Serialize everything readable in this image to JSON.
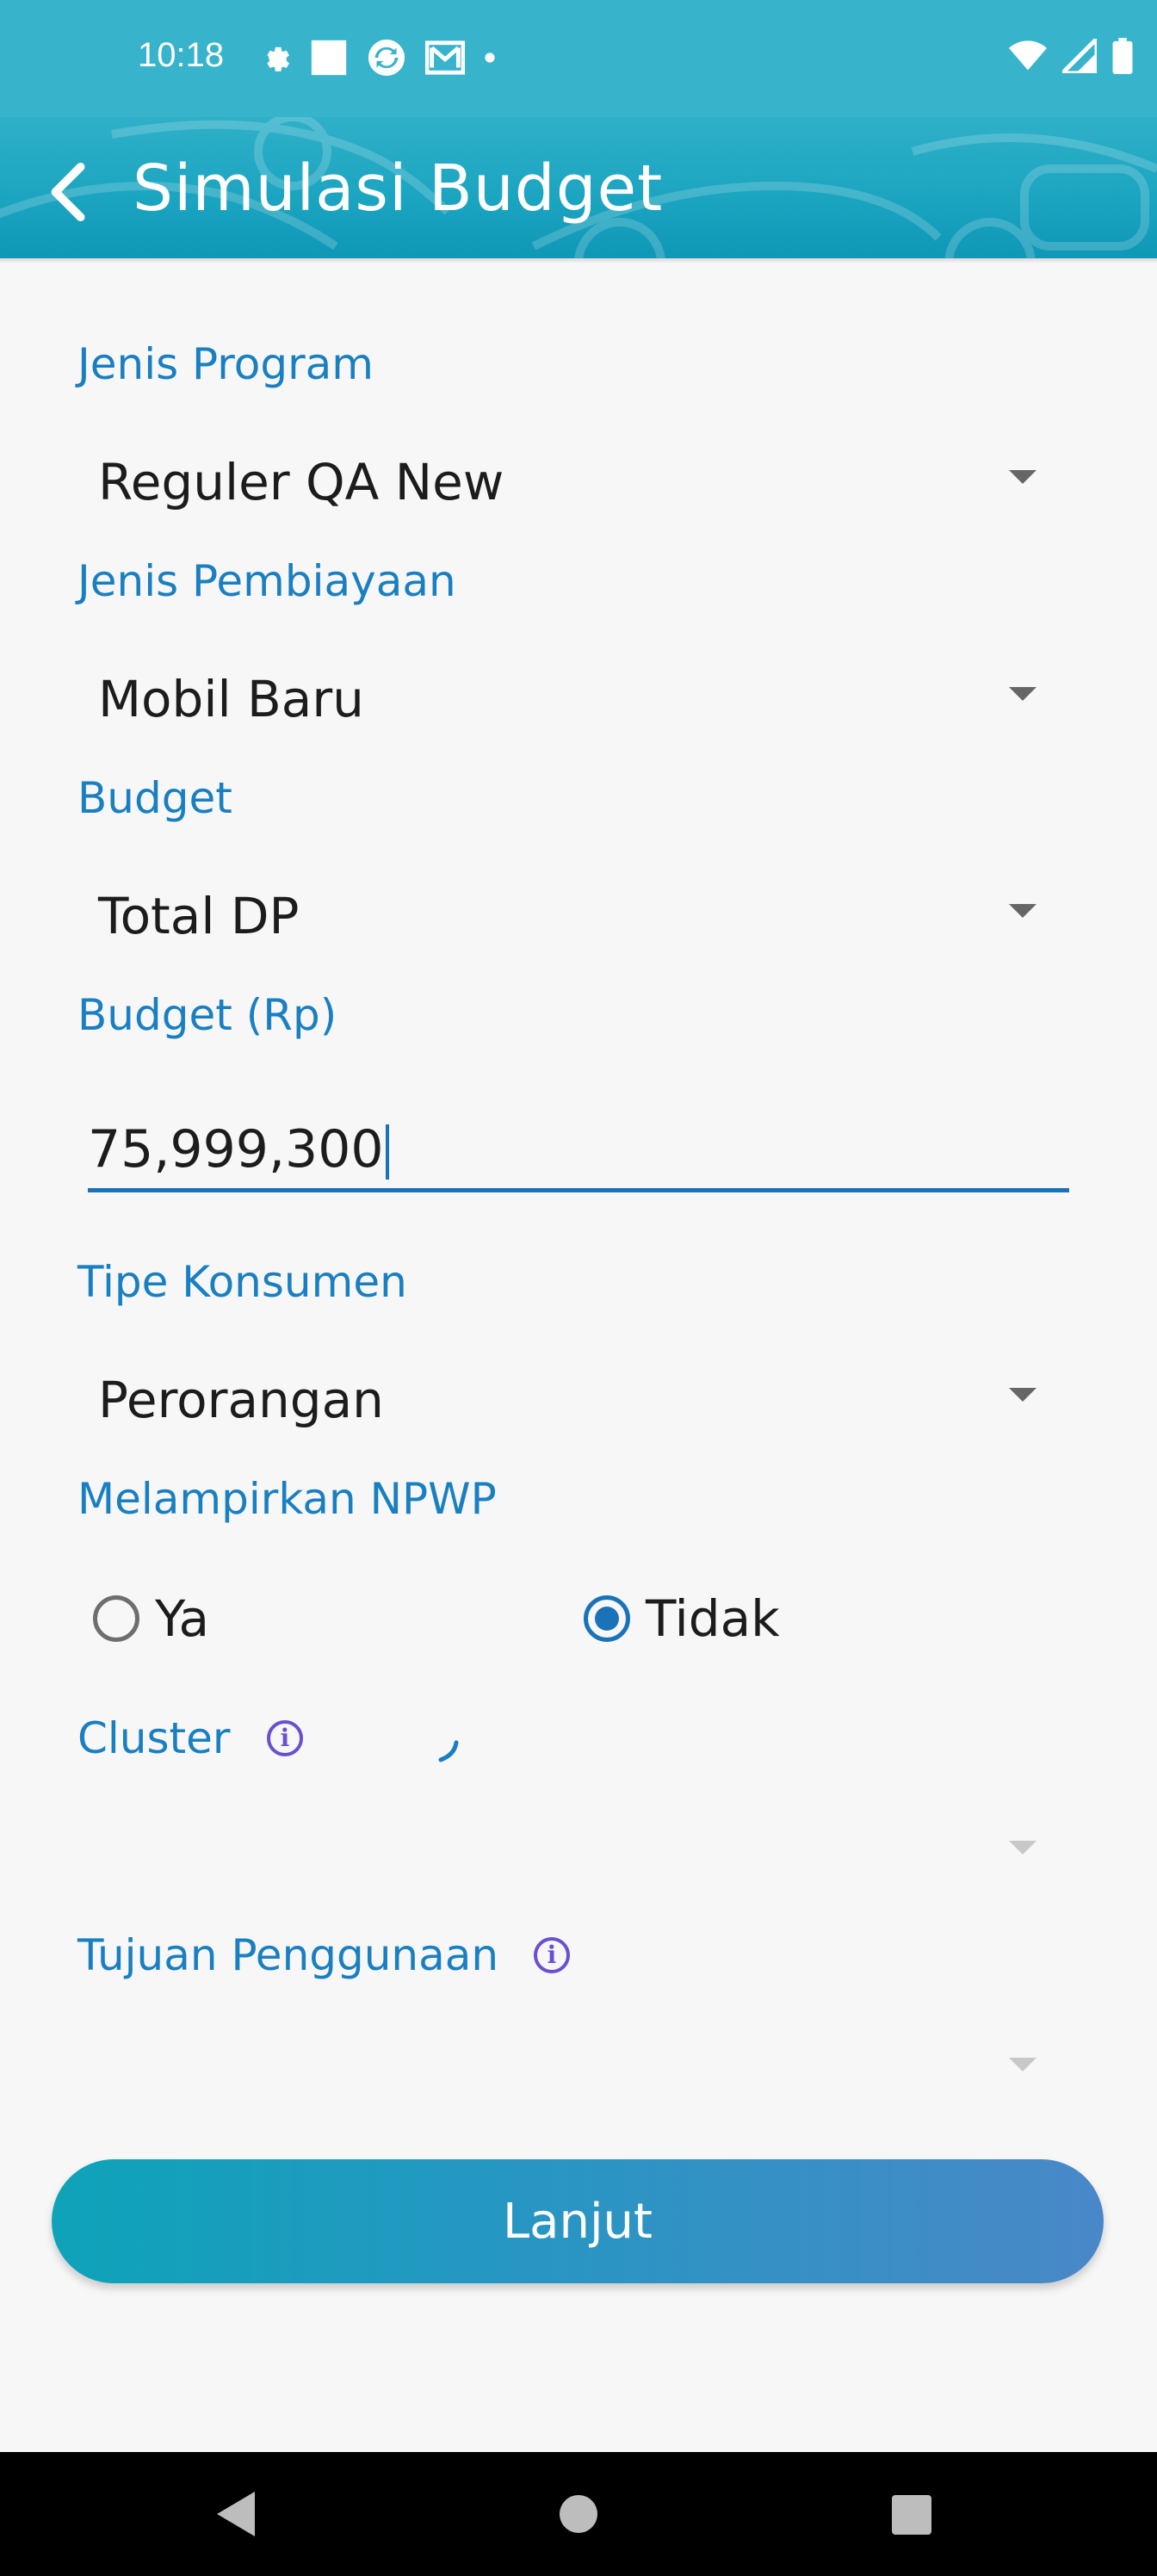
{
  "status_bar": {
    "time": "10:18",
    "left_icons": [
      "gear-icon",
      "square-icon",
      "sync-icon",
      "mail-icon",
      "dot-icon"
    ],
    "right_icons": [
      "wifi-icon",
      "signal-icon",
      "battery-icon"
    ]
  },
  "app_bar": {
    "title": "Simulasi Budget",
    "back_icon": "chevron-left-icon"
  },
  "form": {
    "jenis_program": {
      "label": "Jenis Program",
      "value": "Reguler QA New"
    },
    "jenis_pembiayaan": {
      "label": "Jenis Pembiayaan",
      "value": "Mobil Baru"
    },
    "budget": {
      "label": "Budget",
      "value": "Total DP"
    },
    "budget_rp": {
      "label": "Budget (Rp)",
      "value": "75,999,300"
    },
    "tipe_konsumen": {
      "label": "Tipe Konsumen",
      "value": "Perorangan"
    },
    "npwp": {
      "label": "Melampirkan NPWP",
      "options": [
        {
          "label": "Ya",
          "selected": false
        },
        {
          "label": "Tidak",
          "selected": true
        }
      ]
    },
    "cluster": {
      "label": "Cluster",
      "value": ""
    },
    "tujuan_penggunaan": {
      "label": "Tujuan Penggunaan",
      "value": ""
    }
  },
  "actions": {
    "submit_label": "Lanjut"
  },
  "colors": {
    "accent": "#1a7fc1",
    "header": "#37b3cb",
    "button_start": "#0ea3b9",
    "button_end": "#4988c8",
    "info_icon": "#6b4fd1"
  }
}
